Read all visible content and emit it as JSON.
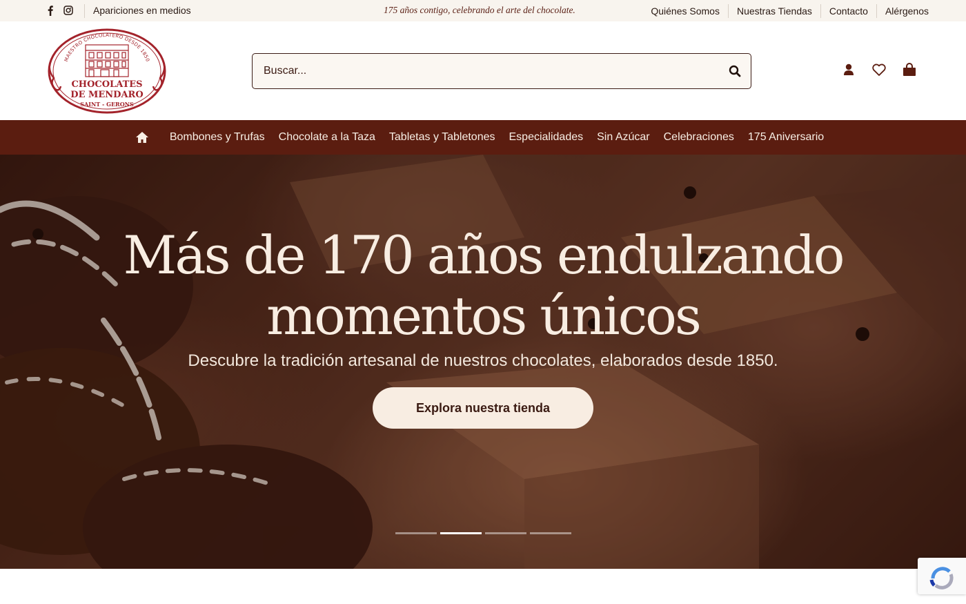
{
  "topbar": {
    "social": [
      {
        "name": "facebook-icon"
      },
      {
        "name": "instagram-icon"
      }
    ],
    "media_link": "Apariciones en medios",
    "tagline": "175 años contigo, celebrando el arte del chocolate.",
    "links": [
      "Quiénes Somos",
      "Nuestras Tiendas",
      "Contacto",
      "Alérgenos"
    ]
  },
  "header": {
    "logo": {
      "arc_text": "MAESTRO CHOCOLATERO DESDE 1850",
      "line1": "CHOCOLATES",
      "line2": "DE MENDARO",
      "line3": "SAINT - GERONS"
    },
    "search_placeholder": "Buscar...",
    "icons": [
      "user-icon",
      "heart-icon",
      "shopping-bag-icon"
    ]
  },
  "nav": {
    "items": [
      "Bombones y Trufas",
      "Chocolate a la Taza",
      "Tabletas y Tabletones",
      "Especialidades",
      "Sin Azúcar",
      "Celebraciones",
      "175 Aniversario"
    ]
  },
  "hero": {
    "title_line1": "Más de 170 años endulzando",
    "title_line2": "momentos únicos",
    "subtitle": "Descubre la tradición artesanal de nuestros chocolates, elaborados desde 1850.",
    "cta": "Explora nuestra tienda",
    "slides": 4,
    "active_slide": 2
  },
  "colors": {
    "brand_dark": "#5b1d10",
    "cream": "#f8ede2",
    "logo_red": "#a3232b",
    "topbar_bg": "#f8f4ee"
  }
}
